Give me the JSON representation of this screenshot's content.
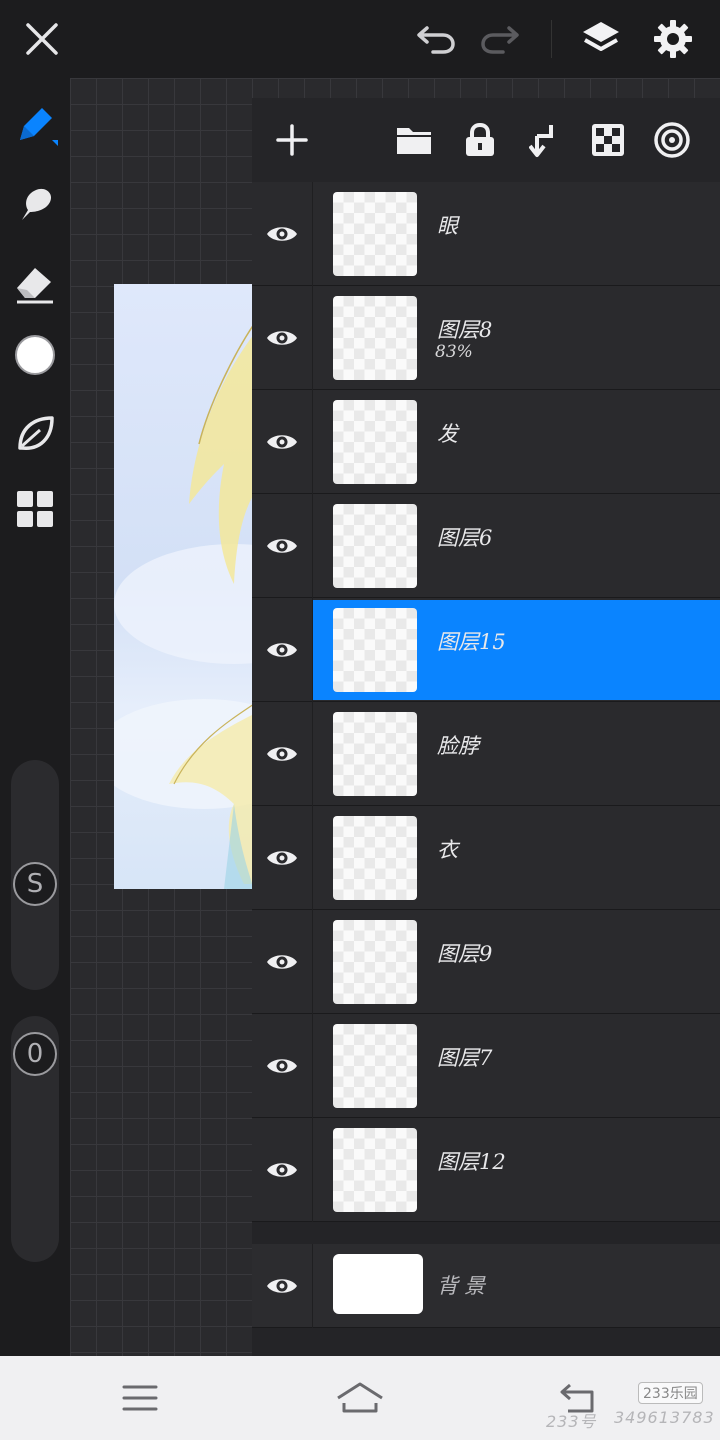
{
  "icons": {
    "close": "close-icon",
    "undo": "undo-icon",
    "redo": "redo-icon",
    "layers": "layers-icon",
    "settings": "gear-icon"
  },
  "toolbar": {
    "tools": [
      "brush-icon",
      "smudge-icon",
      "eraser-icon",
      "color-swatch",
      "leaf-icon",
      "gallery-grid-icon"
    ],
    "size_slider_label": "S",
    "opacity_slider_label": "0"
  },
  "panel": {
    "actions": [
      "add-layer-icon",
      "folder-icon",
      "lock-icon",
      "merge-down-icon",
      "transparency-icon",
      "blend-mode-icon"
    ],
    "selected_color": "#0a84ff",
    "layers": [
      {
        "name": "眼",
        "opacity": ""
      },
      {
        "name": "图层8",
        "opacity": "83%"
      },
      {
        "name": "发",
        "opacity": ""
      },
      {
        "name": "图层6",
        "opacity": ""
      },
      {
        "name": "图层15",
        "opacity": "",
        "selected": true
      },
      {
        "name": "脸脖",
        "opacity": ""
      },
      {
        "name": "衣",
        "opacity": ""
      },
      {
        "name": "图层9",
        "opacity": ""
      },
      {
        "name": "图层7",
        "opacity": ""
      },
      {
        "name": "图层12",
        "opacity": ""
      }
    ],
    "background_layer": "背景"
  },
  "navbar": {
    "watermark_site": "233乐园",
    "watermark_id_label": "233号",
    "watermark_id": "349613783"
  }
}
